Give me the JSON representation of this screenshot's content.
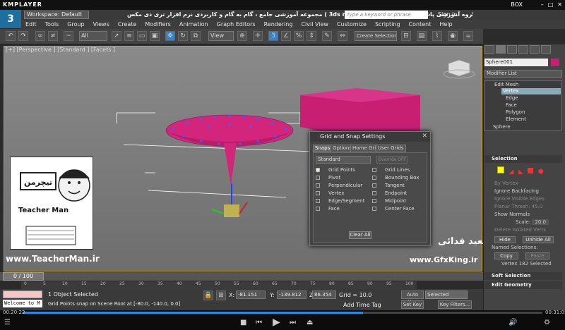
{
  "player": {
    "logo": "KMPLAYER",
    "right_label": "BOX"
  },
  "app": {
    "max_label": "3",
    "workspace": "Workspace: Default",
    "title": "مجموعه آموزشی جامع ، گام به گام و کاربردی نرم افزار تری دی مکس ( 3ds max 2017 )    مدرس : سعید فدایی ( تیچرمن ) گروه آموزشی پادشاه گرافیست ها",
    "search_placeholder": "Type a keyword or phrase",
    "signin": "Sign In"
  },
  "menu": [
    "Edit",
    "Tools",
    "Group",
    "Views",
    "Create",
    "Modifiers",
    "Animation",
    "Graph Editors",
    "Rendering",
    "Civil View",
    "Customize",
    "Scripting",
    "Content",
    "Help"
  ],
  "toolbar": {
    "filter": "All",
    "view": "View",
    "create_selection": "Create Selection Se"
  },
  "viewport": {
    "label": "[+] [Perspective ] [Standard ] [Facets ]"
  },
  "dialog": {
    "title": "Grid and Snap Settings",
    "tabs": [
      "Snaps",
      "Options",
      "Home Grid",
      "User Grids"
    ],
    "preset": "Standard",
    "override": "Override OFF",
    "left_options": [
      {
        "label": "Grid Points",
        "checked": true
      },
      {
        "label": "Pivot",
        "checked": false
      },
      {
        "label": "Perpendicular",
        "checked": false
      },
      {
        "label": "Vertex",
        "checked": false
      },
      {
        "label": "Edge/Segment",
        "checked": false
      },
      {
        "label": "Face",
        "checked": false
      }
    ],
    "right_options": [
      {
        "label": "Grid Lines",
        "checked": false
      },
      {
        "label": "Bounding Box",
        "checked": false
      },
      {
        "label": "Tangent",
        "checked": false
      },
      {
        "label": "Endpoint",
        "checked": false
      },
      {
        "label": "Midpoint",
        "checked": false
      },
      {
        "label": "Center Face",
        "checked": false
      }
    ],
    "clear_all": "Clear All"
  },
  "panel": {
    "object_name": "Sphere001",
    "modifier_list": "Modifier List",
    "stack": [
      "Edit Mesh",
      "Vertex",
      "Edge",
      "Face",
      "Polygon",
      "Element"
    ],
    "base": "Sphere",
    "selection_title": "Selection",
    "by_vertex": "By Vertex",
    "ignore_backfacing": "Ignore Backfacing",
    "ignore_visible_edges": "Ignore Visible Edges",
    "planar_thresh_label": "Planar Thresh:",
    "planar_thresh": "45.0",
    "show_normals": "Show Normals",
    "scale_label": "Scale:",
    "scale": "20.0",
    "delete_isolated": "Delete Isolated Verts",
    "hide": "Hide",
    "unhide_all": "Unhide All",
    "named_selections": "Named Selections:",
    "copy": "Copy",
    "paste": "Paste",
    "vertex_count": "Vertex 182 Selected",
    "soft_selection": "Soft Selection",
    "edit_geometry": "Edit Geometry"
  },
  "timeline": {
    "slider": "0 / 100",
    "ticks": [
      "0",
      "5",
      "10",
      "15",
      "20",
      "25",
      "30",
      "35",
      "40",
      "45",
      "50",
      "55",
      "60",
      "65",
      "70",
      "75",
      "80",
      "85",
      "90",
      "95",
      "100"
    ]
  },
  "status": {
    "welcome": "Welcome to M",
    "selection": "1 Object Selected",
    "prompt": "Grid Points snap on Scene Root at [-80.0, -140.0, 0.0]",
    "x": "-81.151",
    "y": "-139.812",
    "z": "86.354",
    "x_label": "X:",
    "y_label": "Y:",
    "z_label": "Z:",
    "grid": "Grid = 10.0",
    "add_time_tag": "Add Time Tag",
    "auto_key": "Auto Key",
    "set_key": "Set Key",
    "selected": "Selected",
    "key_filters": "Key Filters..."
  },
  "player_ctrl": {
    "time_left": "00:20:22",
    "time_right": "00:31:05",
    "progress": 0.655
  },
  "watermarks": {
    "teacherman_url": "www.TeacherMan.ir",
    "gfxking": "www.GfxKing.ir",
    "name": "سعید فدائی",
    "teacherman": "Teacher Man",
    "logo_fa": "تیچرمن"
  },
  "colors": {
    "accent": "#c81f73",
    "viewport_border": "#c9a227"
  }
}
